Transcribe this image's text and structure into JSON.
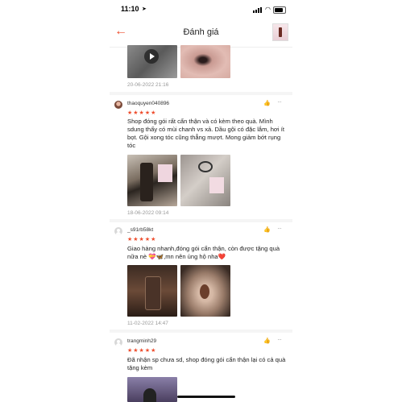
{
  "status_bar": {
    "time": "11:10",
    "location_icon": "location-arrow-icon",
    "signal_icon": "signal-icon",
    "wifi_icon": "wifi-icon",
    "battery_icon": "battery-icon"
  },
  "header": {
    "back_icon": "arrow-left-icon",
    "title": "Đánh giá",
    "product_thumbnail": "product-thumbnail"
  },
  "accent_color": "#ee4d2d",
  "reviews_top": {
    "date": "20-06-2022 21:16"
  },
  "reviews": [
    {
      "username": "thaoquyen040896",
      "stars": "★★★★★",
      "comment": "Shop đóng gói rất cẩn thận và có kèm theo quà. Mình sdung thấy có mùi chanh vs xả. Dầu gội có đặc lắm, hơi ít bọt. Gội xong tóc cũng thẳng mượt. Mong giảm bớt rụng tóc",
      "date": "18-06-2022 09:14"
    },
    {
      "username": "_s91rb58kt",
      "stars": "★★★★★",
      "comment": "Giao hàng nhanh,đóng gói cẩn thận, còn được tặng quà nữa nè 💝🦋,mn nên ủng hộ nha❤️",
      "date": "11-02-2022 14:47"
    },
    {
      "username": "trangminh29",
      "stars": "★★★★★",
      "comment": "Đã nhận sp chưa sd, shop đóng gói cẩn thận lại có cả quà tặng kèm"
    }
  ]
}
